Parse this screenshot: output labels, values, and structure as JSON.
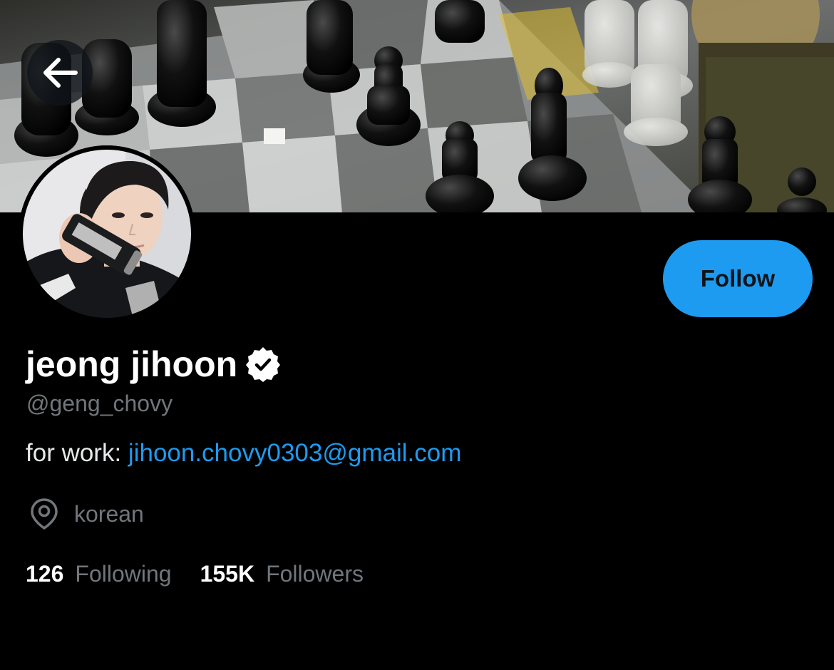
{
  "profile": {
    "display_name": "jeong jihoon",
    "handle": "@geng_chovy",
    "bio_prefix": "for work: ",
    "bio_link": "jihoon.chovy0303@gmail.com",
    "location": "korean",
    "verified": true
  },
  "actions": {
    "follow_label": "Follow",
    "back_icon": "arrow-left-icon"
  },
  "stats": {
    "following_count": "126",
    "following_label": "Following",
    "followers_count": "155K",
    "followers_label": "Followers"
  },
  "icons": {
    "verified": "verified-badge-icon",
    "location": "location-pin-icon"
  },
  "colors": {
    "background": "#000000",
    "accent": "#1d9bf0",
    "primary_text": "#e7e9ea",
    "secondary_text": "#71767b"
  }
}
